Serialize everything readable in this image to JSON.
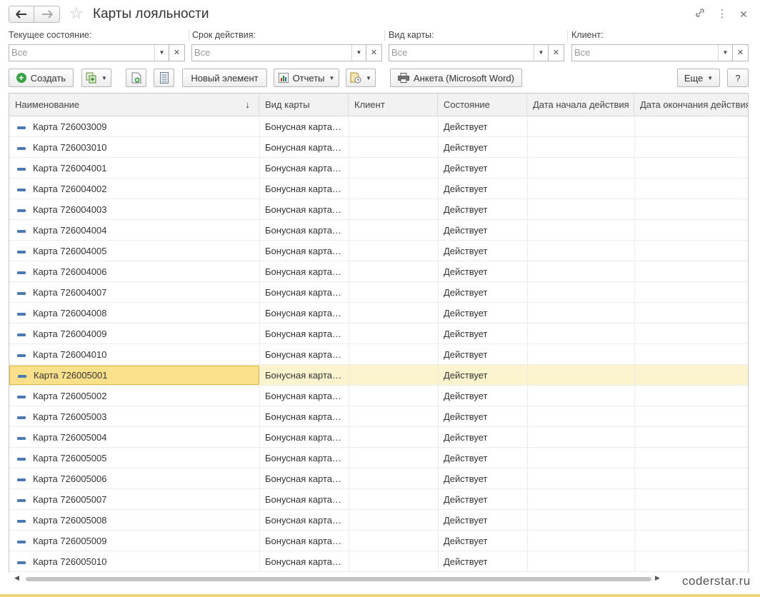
{
  "window": {
    "title": "Карты лояльности"
  },
  "filters": [
    {
      "label": "Текущее состояние:",
      "value": "Все"
    },
    {
      "label": "Срок действия:",
      "value": "Все"
    },
    {
      "label": "Вид карты:",
      "value": "Все"
    },
    {
      "label": "Клиент:",
      "value": "Все"
    }
  ],
  "toolbar": {
    "create_label": "Создать",
    "new_element_label": "Новый элемент",
    "reports_label": "Отчеты",
    "word_label": "Анкета (Microsoft Word)",
    "more_label": "Еще",
    "help_label": "?"
  },
  "table": {
    "columns": [
      "Наименование",
      "Вид карты",
      "Клиент",
      "Состояние",
      "Дата начала действия",
      "Дата окончания действия"
    ],
    "rows": [
      {
        "name": "Карта 726003009",
        "type": "Бонусная карта…",
        "client": "",
        "state": "Действует",
        "start": "",
        "end": ""
      },
      {
        "name": "Карта 726003010",
        "type": "Бонусная карта…",
        "client": "",
        "state": "Действует",
        "start": "",
        "end": ""
      },
      {
        "name": "Карта 726004001",
        "type": "Бонусная карта…",
        "client": "",
        "state": "Действует",
        "start": "",
        "end": ""
      },
      {
        "name": "Карта 726004002",
        "type": "Бонусная карта…",
        "client": "",
        "state": "Действует",
        "start": "",
        "end": ""
      },
      {
        "name": "Карта 726004003",
        "type": "Бонусная карта…",
        "client": "",
        "state": "Действует",
        "start": "",
        "end": ""
      },
      {
        "name": "Карта 726004004",
        "type": "Бонусная карта…",
        "client": "",
        "state": "Действует",
        "start": "",
        "end": ""
      },
      {
        "name": "Карта 726004005",
        "type": "Бонусная карта…",
        "client": "",
        "state": "Действует",
        "start": "",
        "end": ""
      },
      {
        "name": "Карта 726004006",
        "type": "Бонусная карта…",
        "client": "",
        "state": "Действует",
        "start": "",
        "end": ""
      },
      {
        "name": "Карта 726004007",
        "type": "Бонусная карта…",
        "client": "",
        "state": "Действует",
        "start": "",
        "end": ""
      },
      {
        "name": "Карта 726004008",
        "type": "Бонусная карта…",
        "client": "",
        "state": "Действует",
        "start": "",
        "end": ""
      },
      {
        "name": "Карта 726004009",
        "type": "Бонусная карта…",
        "client": "",
        "state": "Действует",
        "start": "",
        "end": ""
      },
      {
        "name": "Карта 726004010",
        "type": "Бонусная карта…",
        "client": "",
        "state": "Действует",
        "start": "",
        "end": ""
      },
      {
        "name": "Карта 726005001",
        "type": "Бонусная карта…",
        "client": "",
        "state": "Действует",
        "start": "",
        "end": "",
        "selected": true
      },
      {
        "name": "Карта 726005002",
        "type": "Бонусная карта…",
        "client": "",
        "state": "Действует",
        "start": "",
        "end": ""
      },
      {
        "name": "Карта 726005003",
        "type": "Бонусная карта…",
        "client": "",
        "state": "Действует",
        "start": "",
        "end": ""
      },
      {
        "name": "Карта 726005004",
        "type": "Бонусная карта…",
        "client": "",
        "state": "Действует",
        "start": "",
        "end": ""
      },
      {
        "name": "Карта 726005005",
        "type": "Бонусная карта…",
        "client": "",
        "state": "Действует",
        "start": "",
        "end": ""
      },
      {
        "name": "Карта 726005006",
        "type": "Бонусная карта…",
        "client": "",
        "state": "Действует",
        "start": "",
        "end": ""
      },
      {
        "name": "Карта 726005007",
        "type": "Бонусная карта…",
        "client": "",
        "state": "Действует",
        "start": "",
        "end": ""
      },
      {
        "name": "Карта 726005008",
        "type": "Бонусная карта…",
        "client": "",
        "state": "Действует",
        "start": "",
        "end": ""
      },
      {
        "name": "Карта 726005009",
        "type": "Бонусная карта…",
        "client": "",
        "state": "Действует",
        "start": "",
        "end": ""
      },
      {
        "name": "Карта 726005010",
        "type": "Бонусная карта…",
        "client": "",
        "state": "Действует",
        "start": "",
        "end": ""
      }
    ]
  },
  "watermark": "coderstar.ru",
  "colors": {
    "selection_row": "#fcf3cf",
    "selection_cell": "#fbe08c",
    "create_icon": "#3aa247",
    "item_icon": "#4a79b3"
  },
  "icons": [
    "back-arrow-icon",
    "forward-arrow-icon",
    "favorite-star-icon",
    "link-icon",
    "more-vert-icon",
    "close-icon",
    "plus-circle-icon",
    "copy-icon",
    "add-doc-icon",
    "list-icon",
    "report-icon",
    "printer-icon",
    "sort-down-icon",
    "item-icon"
  ]
}
